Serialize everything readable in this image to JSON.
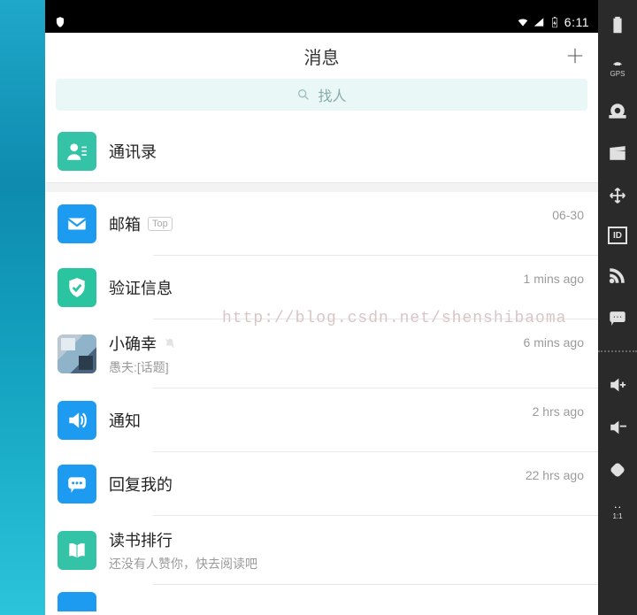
{
  "statusbar": {
    "time": "6:11"
  },
  "header": {
    "title": "消息"
  },
  "search": {
    "placeholder": "找人"
  },
  "contacts": {
    "label": "通讯录"
  },
  "items": [
    {
      "title": "邮箱",
      "badge": "Top",
      "sub": "",
      "time": "06-30",
      "icon": "mail",
      "color": "av-blue"
    },
    {
      "title": "验证信息",
      "sub": "",
      "time": "1 mins ago",
      "icon": "shield",
      "color": "av-shield"
    },
    {
      "title": "小确幸",
      "sub": "愚夫:[话题]",
      "time": "6 mins ago",
      "icon": "img",
      "color": "av-img",
      "muted": true
    },
    {
      "title": "通知",
      "sub": "",
      "time": "2 hrs ago",
      "icon": "speaker",
      "color": "av-blue"
    },
    {
      "title": "回复我的",
      "sub": "",
      "time": "22 hrs ago",
      "icon": "chat",
      "color": "av-blue"
    },
    {
      "title": "读书排行",
      "sub": "还没有人赞你，快去阅读吧",
      "time": "",
      "icon": "book",
      "color": "av-teal"
    }
  ],
  "watermark": "http://blog.csdn.net/shenshibaoma",
  "emu": {
    "gps": "GPS",
    "id": "ID",
    "ratio": "1:1"
  }
}
